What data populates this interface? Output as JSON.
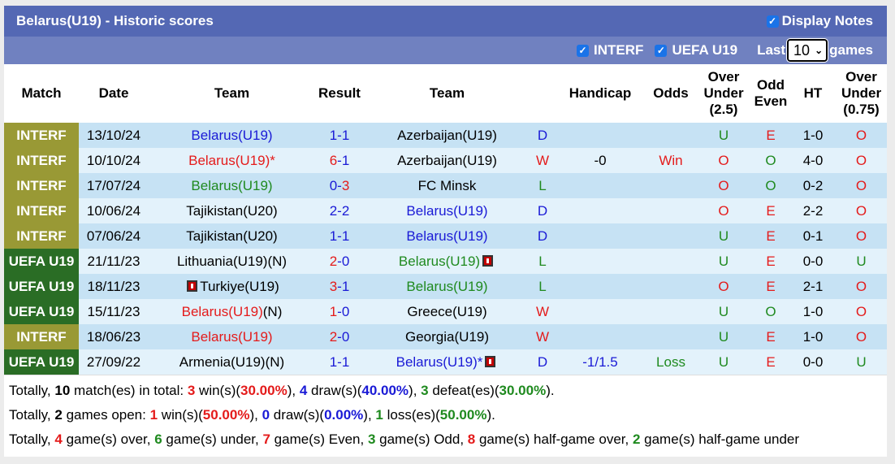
{
  "header": {
    "title": "Belarus(U19) - Historic scores",
    "display_notes_label": "Display Notes",
    "display_notes_checked": true
  },
  "filters": {
    "interf_label": "INTERF",
    "interf_checked": true,
    "uefa_label": "UEFA U19",
    "uefa_checked": true,
    "last_label": "Last",
    "last_value": "10",
    "games_label": "games"
  },
  "columns": {
    "match": "Match",
    "date": "Date",
    "home": "Team",
    "result": "Result",
    "away": "Team",
    "handicap": "Handicap",
    "odds": "Odds",
    "ou_l1": "Over",
    "ou_l2": "Under",
    "ou_l3": "(2.5)",
    "oe_l1": "Odd",
    "oe_l2": "Even",
    "ht": "HT",
    "ou2_l1": "Over",
    "ou2_l2": "Under",
    "ou2_l3": "(0.75)"
  },
  "colors": {
    "interf": "#999935",
    "uefa": "#2a6d25",
    "blue": "#1a1ad6",
    "red": "#e41b1b",
    "green": "#1f8a1f"
  },
  "rows": [
    {
      "league": "INTERF",
      "league_type": "interf",
      "date": "13/10/24",
      "home": "Belarus(U19)",
      "home_color": "blue",
      "home_suffix": "",
      "home_card": false,
      "score_h": "1",
      "score_h_color": "blue",
      "score_a": "1",
      "score_a_color": "blue",
      "away": "Azerbaijan(U19)",
      "away_color": "black",
      "away_suffix": "",
      "away_card": false,
      "res": "D",
      "res_color": "blue",
      "handicap": "",
      "odds": "",
      "odds_color": "black",
      "ou": "U",
      "ou_color": "green",
      "oe": "E",
      "oe_color": "red",
      "ht": "1-0",
      "ou2": "O",
      "ou2_color": "red"
    },
    {
      "league": "INTERF",
      "league_type": "interf",
      "date": "10/10/24",
      "home": "Belarus(U19)*",
      "home_color": "red",
      "home_suffix": "",
      "home_card": false,
      "score_h": "6",
      "score_h_color": "red",
      "score_a": "1",
      "score_a_color": "blue",
      "away": "Azerbaijan(U19)",
      "away_color": "black",
      "away_suffix": "",
      "away_card": false,
      "res": "W",
      "res_color": "red",
      "handicap": "-0",
      "odds": "Win",
      "odds_color": "red",
      "ou": "O",
      "ou_color": "red",
      "oe": "O",
      "oe_color": "green",
      "ht": "4-0",
      "ou2": "O",
      "ou2_color": "red"
    },
    {
      "league": "INTERF",
      "league_type": "interf",
      "date": "17/07/24",
      "home": "Belarus(U19)",
      "home_color": "green",
      "home_suffix": "",
      "home_card": false,
      "score_h": "0",
      "score_h_color": "blue",
      "score_a": "3",
      "score_a_color": "red",
      "away": "FC Minsk",
      "away_color": "black",
      "away_suffix": "",
      "away_card": false,
      "res": "L",
      "res_color": "green",
      "handicap": "",
      "odds": "",
      "odds_color": "black",
      "ou": "O",
      "ou_color": "red",
      "oe": "O",
      "oe_color": "green",
      "ht": "0-2",
      "ou2": "O",
      "ou2_color": "red"
    },
    {
      "league": "INTERF",
      "league_type": "interf",
      "date": "10/06/24",
      "home": "Tajikistan(U20)",
      "home_color": "black",
      "home_suffix": "",
      "home_card": false,
      "score_h": "2",
      "score_h_color": "blue",
      "score_a": "2",
      "score_a_color": "blue",
      "away": "Belarus(U19)",
      "away_color": "blue",
      "away_suffix": "",
      "away_card": false,
      "res": "D",
      "res_color": "blue",
      "handicap": "",
      "odds": "",
      "odds_color": "black",
      "ou": "O",
      "ou_color": "red",
      "oe": "E",
      "oe_color": "red",
      "ht": "2-2",
      "ou2": "O",
      "ou2_color": "red"
    },
    {
      "league": "INTERF",
      "league_type": "interf",
      "date": "07/06/24",
      "home": "Tajikistan(U20)",
      "home_color": "black",
      "home_suffix": "",
      "home_card": false,
      "score_h": "1",
      "score_h_color": "blue",
      "score_a": "1",
      "score_a_color": "blue",
      "away": "Belarus(U19)",
      "away_color": "blue",
      "away_suffix": "",
      "away_card": false,
      "res": "D",
      "res_color": "blue",
      "handicap": "",
      "odds": "",
      "odds_color": "black",
      "ou": "U",
      "ou_color": "green",
      "oe": "E",
      "oe_color": "red",
      "ht": "0-1",
      "ou2": "O",
      "ou2_color": "red"
    },
    {
      "league": "UEFA U19",
      "league_type": "uefa",
      "date": "21/11/23",
      "home": "Lithuania(U19)(N)",
      "home_color": "black",
      "home_suffix": "",
      "home_card": false,
      "score_h": "2",
      "score_h_color": "red",
      "score_a": "0",
      "score_a_color": "blue",
      "away": "Belarus(U19)",
      "away_color": "green",
      "away_suffix": "",
      "away_card": true,
      "res": "L",
      "res_color": "green",
      "handicap": "",
      "odds": "",
      "odds_color": "black",
      "ou": "U",
      "ou_color": "green",
      "oe": "E",
      "oe_color": "red",
      "ht": "0-0",
      "ou2": "U",
      "ou2_color": "green"
    },
    {
      "league": "UEFA U19",
      "league_type": "uefa",
      "date": "18/11/23",
      "home": "Turkiye(U19)",
      "home_color": "black",
      "home_suffix": "",
      "home_card_before": true,
      "home_card": false,
      "score_h": "3",
      "score_h_color": "red",
      "score_a": "1",
      "score_a_color": "blue",
      "away": "Belarus(U19)",
      "away_color": "green",
      "away_suffix": "",
      "away_card": false,
      "res": "L",
      "res_color": "green",
      "handicap": "",
      "odds": "",
      "odds_color": "black",
      "ou": "O",
      "ou_color": "red",
      "oe": "E",
      "oe_color": "red",
      "ht": "2-1",
      "ou2": "O",
      "ou2_color": "red"
    },
    {
      "league": "UEFA U19",
      "league_type": "uefa",
      "date": "15/11/23",
      "home": "Belarus(U19)",
      "home_color": "red",
      "home_suffix": "(N)",
      "home_card": false,
      "score_h": "1",
      "score_h_color": "red",
      "score_a": "0",
      "score_a_color": "blue",
      "away": "Greece(U19)",
      "away_color": "black",
      "away_suffix": "",
      "away_card": false,
      "res": "W",
      "res_color": "red",
      "handicap": "",
      "odds": "",
      "odds_color": "black",
      "ou": "U",
      "ou_color": "green",
      "oe": "O",
      "oe_color": "green",
      "ht": "1-0",
      "ou2": "O",
      "ou2_color": "red"
    },
    {
      "league": "INTERF",
      "league_type": "interf",
      "date": "18/06/23",
      "home": "Belarus(U19)",
      "home_color": "red",
      "home_suffix": "",
      "home_card": false,
      "score_h": "2",
      "score_h_color": "red",
      "score_a": "0",
      "score_a_color": "blue",
      "away": "Georgia(U19)",
      "away_color": "black",
      "away_suffix": "",
      "away_card": false,
      "res": "W",
      "res_color": "red",
      "handicap": "",
      "odds": "",
      "odds_color": "black",
      "ou": "U",
      "ou_color": "green",
      "oe": "E",
      "oe_color": "red",
      "ht": "1-0",
      "ou2": "O",
      "ou2_color": "red"
    },
    {
      "league": "UEFA U19",
      "league_type": "uefa",
      "date": "27/09/22",
      "home": "Armenia(U19)(N)",
      "home_color": "black",
      "home_suffix": "",
      "home_card": false,
      "score_h": "1",
      "score_h_color": "blue",
      "score_a": "1",
      "score_a_color": "blue",
      "away": "Belarus(U19)*",
      "away_color": "blue",
      "away_suffix": "",
      "away_card": true,
      "res": "D",
      "res_color": "blue",
      "handicap": "-1/1.5",
      "odds": "Loss",
      "odds_color": "green",
      "ou": "U",
      "ou_color": "green",
      "oe": "E",
      "oe_color": "red",
      "ht": "0-0",
      "ou2": "U",
      "ou2_color": "green"
    }
  ],
  "summary": {
    "line1": [
      {
        "t": "Totally, ",
        "c": "black",
        "b": false
      },
      {
        "t": "10",
        "c": "black",
        "b": true
      },
      {
        "t": " match(es) in total: ",
        "c": "black",
        "b": false
      },
      {
        "t": "3",
        "c": "red",
        "b": true
      },
      {
        "t": " win(s)(",
        "c": "black",
        "b": false
      },
      {
        "t": "30.00%",
        "c": "red",
        "b": true
      },
      {
        "t": "), ",
        "c": "black",
        "b": false
      },
      {
        "t": "4",
        "c": "blue",
        "b": true
      },
      {
        "t": " draw(s)(",
        "c": "black",
        "b": false
      },
      {
        "t": "40.00%",
        "c": "blue",
        "b": true
      },
      {
        "t": "), ",
        "c": "black",
        "b": false
      },
      {
        "t": "3",
        "c": "green",
        "b": true
      },
      {
        "t": " defeat(es)(",
        "c": "black",
        "b": false
      },
      {
        "t": "30.00%",
        "c": "green",
        "b": true
      },
      {
        "t": ").",
        "c": "black",
        "b": false
      }
    ],
    "line2": [
      {
        "t": "Totally, ",
        "c": "black",
        "b": false
      },
      {
        "t": "2",
        "c": "black",
        "b": true
      },
      {
        "t": " games open: ",
        "c": "black",
        "b": false
      },
      {
        "t": "1",
        "c": "red",
        "b": true
      },
      {
        "t": " win(s)(",
        "c": "black",
        "b": false
      },
      {
        "t": "50.00%",
        "c": "red",
        "b": true
      },
      {
        "t": "), ",
        "c": "black",
        "b": false
      },
      {
        "t": "0",
        "c": "blue",
        "b": true
      },
      {
        "t": " draw(s)(",
        "c": "black",
        "b": false
      },
      {
        "t": "0.00%",
        "c": "blue",
        "b": true
      },
      {
        "t": "), ",
        "c": "black",
        "b": false
      },
      {
        "t": "1",
        "c": "green",
        "b": true
      },
      {
        "t": " loss(es)(",
        "c": "black",
        "b": false
      },
      {
        "t": "50.00%",
        "c": "green",
        "b": true
      },
      {
        "t": ").",
        "c": "black",
        "b": false
      }
    ],
    "line3": [
      {
        "t": "Totally, ",
        "c": "black",
        "b": false
      },
      {
        "t": "4",
        "c": "red",
        "b": true
      },
      {
        "t": " game(s) over, ",
        "c": "black",
        "b": false
      },
      {
        "t": "6",
        "c": "green",
        "b": true
      },
      {
        "t": " game(s) under, ",
        "c": "black",
        "b": false
      },
      {
        "t": "7",
        "c": "red",
        "b": true
      },
      {
        "t": " game(s) Even, ",
        "c": "black",
        "b": false
      },
      {
        "t": "3",
        "c": "green",
        "b": true
      },
      {
        "t": " game(s) Odd, ",
        "c": "black",
        "b": false
      },
      {
        "t": "8",
        "c": "red",
        "b": true
      },
      {
        "t": " game(s) half-game over, ",
        "c": "black",
        "b": false
      },
      {
        "t": "2",
        "c": "green",
        "b": true
      },
      {
        "t": " game(s) half-game under",
        "c": "black",
        "b": false
      }
    ]
  }
}
